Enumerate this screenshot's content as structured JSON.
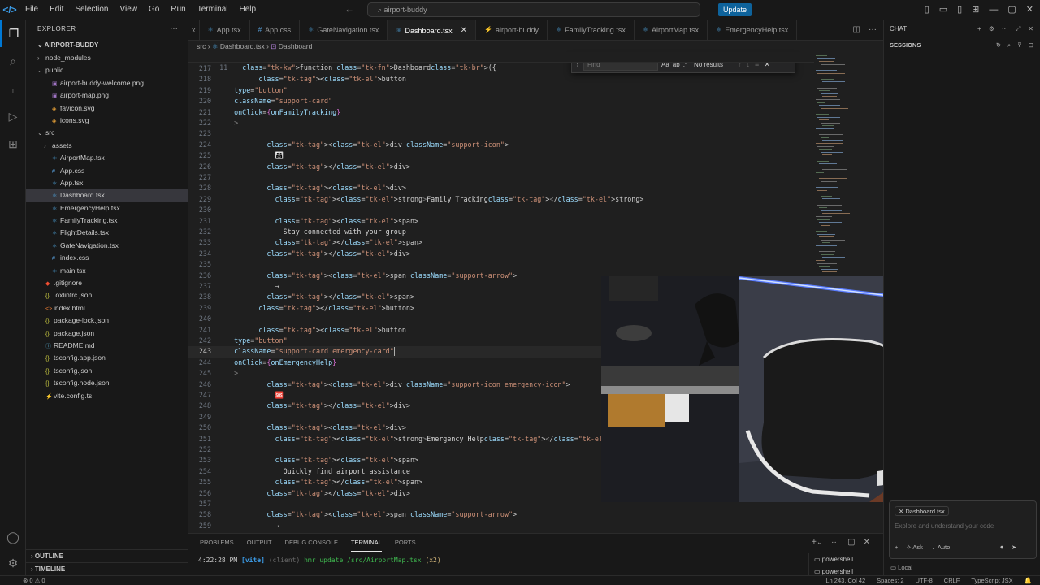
{
  "titlebar": {
    "menu": [
      "File",
      "Edit",
      "Selection",
      "View",
      "Go",
      "Run",
      "Terminal",
      "Help"
    ],
    "search": "airport-buddy",
    "update_label": "Update"
  },
  "explorer": {
    "header": "EXPLORER",
    "project": "AIRPORT-BUDDY",
    "items": [
      {
        "label": "node_modules",
        "type": "folder",
        "open": false,
        "depth": 1
      },
      {
        "label": "public",
        "type": "folder",
        "open": true,
        "depth": 1
      },
      {
        "label": "airport-buddy-welcome.png",
        "type": "image",
        "depth": 2
      },
      {
        "label": "airport-map.png",
        "type": "image",
        "depth": 2
      },
      {
        "label": "favicon.svg",
        "type": "svg",
        "depth": 2
      },
      {
        "label": "icons.svg",
        "type": "svg",
        "depth": 2
      },
      {
        "label": "src",
        "type": "folder",
        "open": true,
        "depth": 1
      },
      {
        "label": "assets",
        "type": "folder",
        "open": false,
        "depth": 2
      },
      {
        "label": "AirportMap.tsx",
        "type": "tsx",
        "depth": 2
      },
      {
        "label": "App.css",
        "type": "css",
        "depth": 2
      },
      {
        "label": "App.tsx",
        "type": "tsx",
        "depth": 2
      },
      {
        "label": "Dashboard.tsx",
        "type": "tsx",
        "depth": 2,
        "selected": true
      },
      {
        "label": "EmergencyHelp.tsx",
        "type": "tsx",
        "depth": 2
      },
      {
        "label": "FamilyTracking.tsx",
        "type": "tsx",
        "depth": 2
      },
      {
        "label": "FlightDetails.tsx",
        "type": "tsx",
        "depth": 2
      },
      {
        "label": "GateNavigation.tsx",
        "type": "tsx",
        "depth": 2
      },
      {
        "label": "index.css",
        "type": "css",
        "depth": 2
      },
      {
        "label": "main.tsx",
        "type": "tsx",
        "depth": 2
      },
      {
        "label": ".gitignore",
        "type": "git",
        "depth": 1
      },
      {
        "label": ".oxlintrc.json",
        "type": "json",
        "depth": 1
      },
      {
        "label": "index.html",
        "type": "html",
        "depth": 1
      },
      {
        "label": "package-lock.json",
        "type": "json",
        "depth": 1
      },
      {
        "label": "package.json",
        "type": "json",
        "depth": 1
      },
      {
        "label": "README.md",
        "type": "md",
        "depth": 1
      },
      {
        "label": "tsconfig.app.json",
        "type": "json",
        "depth": 1
      },
      {
        "label": "tsconfig.json",
        "type": "json",
        "depth": 1
      },
      {
        "label": "tsconfig.node.json",
        "type": "json",
        "depth": 1
      },
      {
        "label": "vite.config.ts",
        "type": "ts",
        "depth": 1
      }
    ],
    "outline": "OUTLINE",
    "timeline": "TIMELINE"
  },
  "tabs": [
    {
      "label": "x",
      "type": "partial"
    },
    {
      "label": "App.tsx",
      "type": "tsx"
    },
    {
      "label": "App.css",
      "type": "css"
    },
    {
      "label": "GateNavigation.tsx",
      "type": "tsx"
    },
    {
      "label": "Dashboard.tsx",
      "type": "tsx",
      "active": true
    },
    {
      "label": "airport-buddy",
      "type": "vite"
    },
    {
      "label": "FamilyTracking.tsx",
      "type": "tsx"
    },
    {
      "label": "AirportMap.tsx",
      "type": "tsx"
    },
    {
      "label": "EmergencyHelp.tsx",
      "type": "tsx"
    }
  ],
  "breadcrumb": {
    "parts": [
      "src",
      "Dashboard.tsx",
      "Dashboard"
    ]
  },
  "sticky": {
    "num": "11",
    "text": "function Dashboard({"
  },
  "code": [
    {
      "n": "217",
      "t": ""
    },
    {
      "n": "218",
      "t": "        <button"
    },
    {
      "n": "219",
      "t": "type=\"button\""
    },
    {
      "n": "220",
      "t": "className=\"support-card\""
    },
    {
      "n": "221",
      "t": "onClick={onFamilyTracking}"
    },
    {
      "n": "222",
      "t": ">"
    },
    {
      "n": "223",
      "t": ""
    },
    {
      "n": "224",
      "t": "          <div className=\"support-icon\">"
    },
    {
      "n": "225",
      "t": "            👨‍👩‍👧"
    },
    {
      "n": "226",
      "t": "          </div>"
    },
    {
      "n": "227",
      "t": ""
    },
    {
      "n": "228",
      "t": "          <div>"
    },
    {
      "n": "229",
      "t": "            <strong>Family Tracking</strong>"
    },
    {
      "n": "230",
      "t": ""
    },
    {
      "n": "231",
      "t": "            <span>"
    },
    {
      "n": "232",
      "t": "              Stay connected with your group"
    },
    {
      "n": "233",
      "t": "            </span>"
    },
    {
      "n": "234",
      "t": "          </div>"
    },
    {
      "n": "235",
      "t": ""
    },
    {
      "n": "236",
      "t": "          <span className=\"support-arrow\">"
    },
    {
      "n": "237",
      "t": "            →"
    },
    {
      "n": "238",
      "t": "          </span>"
    },
    {
      "n": "239",
      "t": "        </button>"
    },
    {
      "n": "240",
      "t": ""
    },
    {
      "n": "241",
      "t": "        <button"
    },
    {
      "n": "242",
      "t": "type=\"button\""
    },
    {
      "n": "243",
      "t": "className=\"support-card emergency-card\"",
      "cur": true
    },
    {
      "n": "244",
      "t": "onClick={onEmergencyHelp}"
    },
    {
      "n": "245",
      "t": ">"
    },
    {
      "n": "246",
      "t": "          <div className=\"support-icon emergency-icon\">"
    },
    {
      "n": "247",
      "t": "            🆘"
    },
    {
      "n": "248",
      "t": "          </div>"
    },
    {
      "n": "249",
      "t": ""
    },
    {
      "n": "250",
      "t": "          <div>"
    },
    {
      "n": "251",
      "t": "            <strong>Emergency Help</strong>"
    },
    {
      "n": "252",
      "t": ""
    },
    {
      "n": "253",
      "t": "            <span>"
    },
    {
      "n": "254",
      "t": "              Quickly find airport assistance"
    },
    {
      "n": "255",
      "t": "            </span>"
    },
    {
      "n": "256",
      "t": "          </div>"
    },
    {
      "n": "257",
      "t": ""
    },
    {
      "n": "258",
      "t": "          <span className=\"support-arrow\">"
    },
    {
      "n": "259",
      "t": "            →"
    }
  ],
  "find": {
    "placeholder": "Find",
    "result": "No results",
    "opts": [
      "Aa",
      "ab",
      ".*"
    ]
  },
  "chat": {
    "header": "CHAT",
    "sessions": "SESSIONS",
    "context_file": "Dashboard.tsx",
    "placeholder": "Explore and understand your code",
    "mode_ask": "Ask",
    "mode_auto": "Auto",
    "local": "Local"
  },
  "panel": {
    "tabs": [
      "PROBLEMS",
      "OUTPUT",
      "DEBUG CONSOLE",
      "TERMINAL",
      "PORTS"
    ],
    "active_tab": "TERMINAL",
    "terminal": {
      "time": "4:22:28 PM",
      "tool": "[vite]",
      "client": "(client)",
      "msg": "hmr update /src/AirportMap.tsx",
      "count": "(x2)"
    },
    "shells": [
      "powershell",
      "powershell"
    ]
  },
  "status": {
    "left": "⊗ 0 ⚠ 0",
    "cursor": "Ln 243, Col 42",
    "spaces": "Spaces: 2",
    "encoding": "UTF-8",
    "eol": "CRLF",
    "language": "TypeScript JSX"
  },
  "colors": {
    "accent": "#0078d4",
    "bg": "#1f1f1f",
    "update": "#0e639c"
  }
}
